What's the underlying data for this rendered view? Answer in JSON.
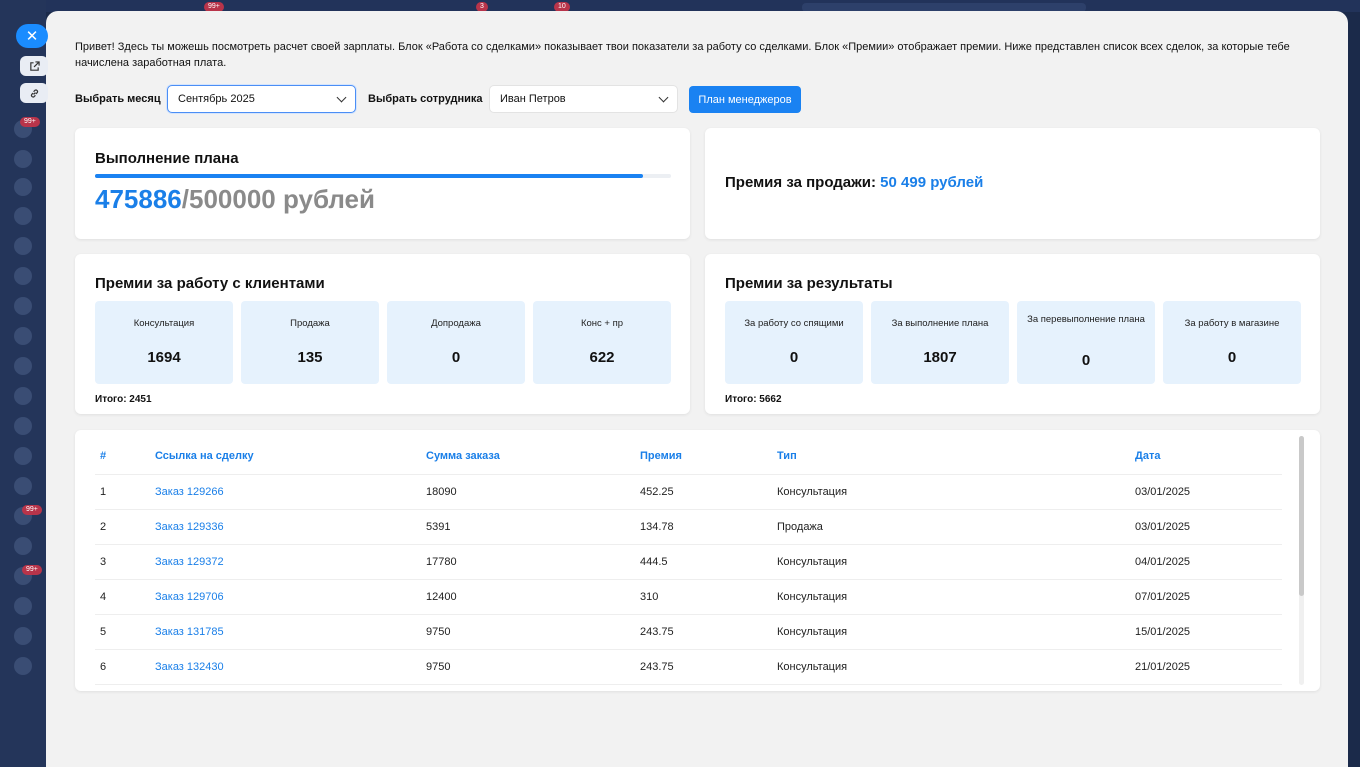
{
  "intro_text": "Привет! Здесь ты можешь посмотреть расчет своей зарплаты. Блок «Работа со сделками» показывает твои показатели за работу со сделками. Блок «Премии» отображает премии. Ниже представлен список всех сделок, за которые тебе начислена заработная плата.",
  "controls": {
    "month_label": "Выбрать месяц",
    "month_value": "Сентябрь 2025",
    "employee_label": "Выбрать сотрудника",
    "employee_value": "Иван Петров",
    "plan_button": "План менеджеров"
  },
  "plan": {
    "title": "Выполнение плана",
    "current": "475886",
    "total": "/500000 рублей",
    "progress_fraction": 0.952
  },
  "sales_bonus": {
    "label": "Премия за продажи: ",
    "amount": "50 499 рублей"
  },
  "client_bonuses": {
    "title": "Премии за работу с клиентами",
    "tiles": [
      {
        "label": "Консультация",
        "value": "1694"
      },
      {
        "label": "Продажа",
        "value": "135"
      },
      {
        "label": "Допродажа",
        "value": "0"
      },
      {
        "label": "Конс + пр",
        "value": "622"
      }
    ],
    "total": "Итого: 2451"
  },
  "result_bonuses": {
    "title": "Премии за результаты",
    "tiles": [
      {
        "label": "За работу со спящими",
        "value": "0"
      },
      {
        "label": "За выполнение плана",
        "value": "1807"
      },
      {
        "label": "За перевыполнение плана",
        "value": "0"
      },
      {
        "label": "За работу в магазине",
        "value": "0"
      }
    ],
    "total": "Итого: 5662"
  },
  "table": {
    "headers": [
      "#",
      "Ссылка на сделку",
      "Сумма заказа",
      "Премия",
      "Тип",
      "Дата"
    ],
    "rows": [
      {
        "num": "1",
        "link": "Заказ 129266",
        "sum": "18090",
        "bonus": "452.25",
        "type": "Консультация",
        "date": "03/01/2025"
      },
      {
        "num": "2",
        "link": "Заказ 129336",
        "sum": "5391",
        "bonus": "134.78",
        "type": "Продажа",
        "date": "03/01/2025"
      },
      {
        "num": "3",
        "link": "Заказ 129372",
        "sum": "17780",
        "bonus": "444.5",
        "type": "Консультация",
        "date": "04/01/2025"
      },
      {
        "num": "4",
        "link": "Заказ 129706",
        "sum": "12400",
        "bonus": "310",
        "type": "Консультация",
        "date": "07/01/2025"
      },
      {
        "num": "5",
        "link": "Заказ 131785",
        "sum": "9750",
        "bonus": "243.75",
        "type": "Консультация",
        "date": "15/01/2025"
      },
      {
        "num": "6",
        "link": "Заказ 132430",
        "sum": "9750",
        "bonus": "243.75",
        "type": "Консультация",
        "date": "21/01/2025"
      }
    ]
  },
  "background": {
    "badges": [
      "99+",
      "3",
      "10"
    ],
    "side_badges": [
      "99+",
      "99+",
      "99+"
    ]
  },
  "icons": {
    "close": "close-icon",
    "open_external": "external-link-icon",
    "link": "link-icon",
    "dropdown": "chevron-down-icon"
  },
  "colors": {
    "accent": "#1a82f2",
    "tile_bg": "#e6f2fd",
    "modal_bg": "#f2f2f2",
    "backdrop": "#1b2a4a"
  }
}
